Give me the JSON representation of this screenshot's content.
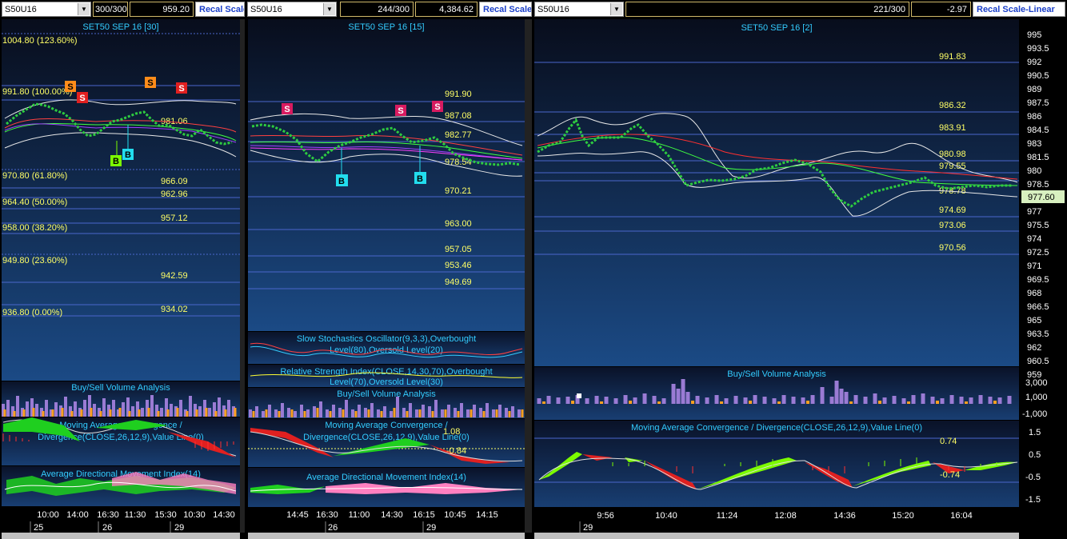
{
  "panes": [
    {
      "symbol": "S50U16",
      "bars": "300/300",
      "value": "959.20",
      "recal": "Recal Scale",
      "title": "SET50 SEP 16  [30]",
      "fib_levels": [
        "1004.80 (123.60%)",
        "991.80 (100.00%)",
        "970.80 (61.80%)",
        "964.40 (50.00%)",
        "958.00 (38.20%)",
        "949.80 (23.60%)",
        "936.80 (0.00%)"
      ],
      "price_labels": [
        "981.06",
        "966.09",
        "962.96",
        "957.12",
        "942.59",
        "934.02"
      ],
      "signals": [
        "S",
        "S",
        "S",
        "S",
        "B",
        "B"
      ],
      "volume_title": "Buy/Sell Volume Analysis",
      "macd_title": [
        "Moving Average Convergence /",
        "Divergence(CLOSE,26,12,9),Value Line(0)"
      ],
      "adx_title": "Average Directional Movement Index(14)",
      "time_labels": [
        "10:00",
        "14:00",
        "16:30",
        "11:30",
        "15:30",
        "10:30",
        "14:30"
      ],
      "date_labels": [
        "25",
        "26",
        "29"
      ]
    },
    {
      "symbol": "S50U16",
      "bars": "244/300",
      "value": "4,384.62",
      "recal": "Recal Scale",
      "title": "SET50 SEP 16  [15]",
      "price_labels": [
        "991.90",
        "987.08",
        "982.77",
        "978.54",
        "970.21",
        "963.00",
        "957.05",
        "953.46",
        "949.69"
      ],
      "signals": [
        "S",
        "S",
        "S",
        "B",
        "B"
      ],
      "stoch_title": [
        "Slow Stochastics Oscillator(9,3,3),Overbought",
        "Level(80),Oversold Level(20)"
      ],
      "rsi_title": [
        "Relative Strength Index(CLOSE,14,30,70),Overbought",
        "Level(70),Oversold Level(30)"
      ],
      "volume_title": "Buy/Sell Volume Analysis",
      "macd_title": [
        "Moving Average Convergence /",
        "Divergence(CLOSE,26,12,9),Value Line(0)"
      ],
      "macd_values": [
        "1.08",
        "-0.84"
      ],
      "adx_title": "Average Directional Movement Index(14)",
      "time_labels": [
        "14:45",
        "16:30",
        "11:00",
        "14:30",
        "16:15",
        "10:45",
        "14:15"
      ],
      "date_labels": [
        "26",
        "29"
      ]
    },
    {
      "symbol": "S50U16",
      "bars": "221/300",
      "value": "-2.97",
      "recal": "Recal Scale-Linear",
      "title": "SET50 SEP 16  [2]",
      "price_labels": [
        "991.83",
        "986.32",
        "983.91",
        "980.98",
        "979.55",
        "978.78",
        "974.69",
        "973.06",
        "970.56"
      ],
      "current_price": "977.60",
      "axis_prices": [
        "995",
        "993.5",
        "992",
        "990.5",
        "989",
        "987.5",
        "986",
        "984.5",
        "983",
        "981.5",
        "980",
        "978.5",
        "977",
        "975.5",
        "974",
        "972.5",
        "971",
        "969.5",
        "968",
        "966.5",
        "965",
        "963.5",
        "962",
        "960.5",
        "959"
      ],
      "volume_title": "Buy/Sell Volume Analysis",
      "volume_axis": [
        "3,000",
        "1,000",
        "-1,000"
      ],
      "macd_title": "Moving Average Convergence / Divergence(CLOSE,26,12,9),Value Line(0)",
      "macd_values": [
        "0.74",
        "-0.74"
      ],
      "macd_axis": [
        "1.5",
        "0.5",
        "-0.5",
        "-1.5"
      ],
      "time_labels": [
        "9:56",
        "10:40",
        "11:24",
        "12:08",
        "14:36",
        "15:20",
        "16:04"
      ],
      "date_labels": [
        "29"
      ]
    }
  ],
  "colors": {
    "bg_top": "#0a1020",
    "bg_bottom": "#1b4a85",
    "grid_line": "#4a66cc",
    "label_yellow": "#ffff66",
    "title_cyan": "#33ccff",
    "sell_orange": "#ff8c1a",
    "sell_red": "#e02020",
    "sell_magenta": "#d81b60",
    "buy_cyan": "#22ddee",
    "buy_green": "#7cfc00"
  }
}
